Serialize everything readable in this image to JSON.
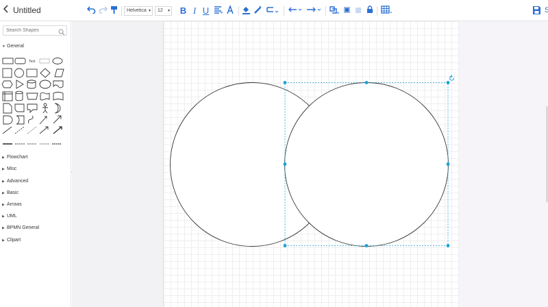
{
  "app": {
    "title": "Untitled",
    "save_label": "S"
  },
  "toolbar": {
    "font_family": "Helvetica",
    "font_size": "12"
  },
  "sidebar": {
    "search_placeholder": "Search Shapes",
    "general_label": "General",
    "shape_text_label": "Text",
    "categories": [
      "Flowchart",
      "Misc",
      "Advanced",
      "Basic",
      "Arrows",
      "UML",
      "BPMN General",
      "Clipart"
    ]
  },
  "colors": {
    "accent": "#2a6fd6",
    "selection": "#1ba1d6"
  }
}
